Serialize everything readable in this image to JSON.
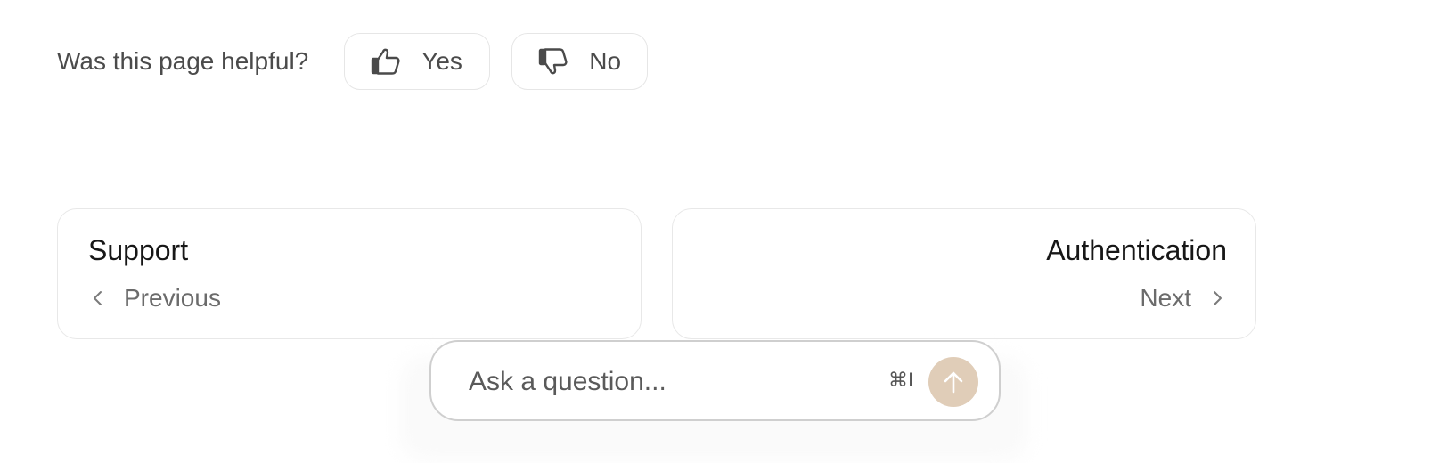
{
  "feedback": {
    "question": "Was this page helpful?",
    "yes_label": "Yes",
    "no_label": "No",
    "yes_icon": "thumbs-up-icon",
    "no_icon": "thumbs-down-icon"
  },
  "pagination": {
    "previous": {
      "title": "Support",
      "label": "Previous",
      "icon": "chevron-left-icon"
    },
    "next": {
      "title": "Authentication",
      "label": "Next",
      "icon": "chevron-right-icon"
    }
  },
  "assistant": {
    "placeholder": "Ask a question...",
    "shortcut": "⌘I",
    "send_icon": "arrow-up-icon",
    "accent_color": "#e0cdb8"
  }
}
